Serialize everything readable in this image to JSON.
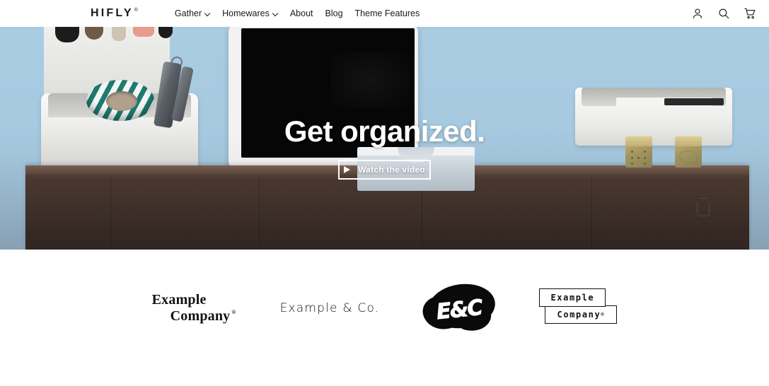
{
  "header": {
    "brand": "HIFLY",
    "brand_mark": "®",
    "nav": [
      {
        "label": "Gather",
        "has_dropdown": true
      },
      {
        "label": "Homewares",
        "has_dropdown": true
      },
      {
        "label": "About",
        "has_dropdown": false
      },
      {
        "label": "Blog",
        "has_dropdown": false
      },
      {
        "label": "Theme Features",
        "has_dropdown": false
      }
    ],
    "icons": [
      {
        "name": "account-icon"
      },
      {
        "name": "search-icon"
      },
      {
        "name": "cart-icon"
      }
    ]
  },
  "hero": {
    "title": "Get organized.",
    "button_label": "Watch the video",
    "play_icon": "play-icon",
    "background_color": "#a9cce3",
    "wood_color": "#4c3a31",
    "text_color": "#ffffff"
  },
  "logo_bar": {
    "logos": [
      {
        "name": "example-company-serif",
        "line1": "Example",
        "line2": "Company",
        "mark": "®"
      },
      {
        "name": "example-and-co",
        "text": "Example & Co."
      },
      {
        "name": "e-and-c-blob",
        "text": "E&C"
      },
      {
        "name": "example-company-boxed",
        "line1": "Example",
        "line2": "Company",
        "mark": "®"
      }
    ]
  }
}
